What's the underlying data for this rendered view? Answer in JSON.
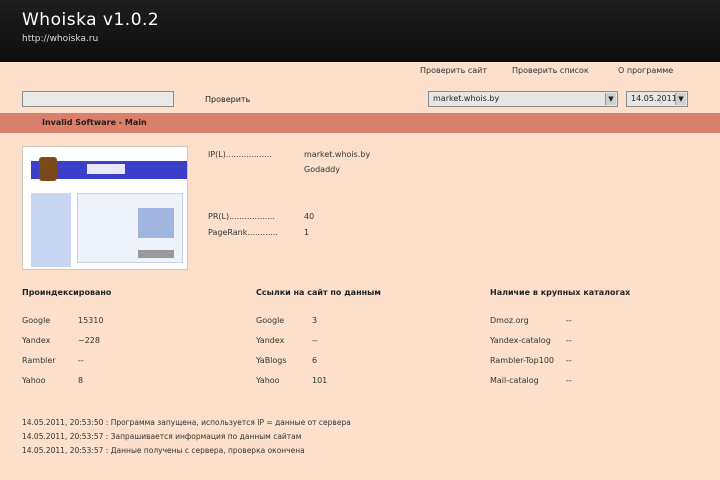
{
  "app": {
    "title": "Whoiska v1.0.2",
    "subtitle": "http://whoiska.ru"
  },
  "menu": {
    "item1": "Проверить сайт",
    "item2": "Проверить список",
    "item3": "О программе"
  },
  "toolbar": {
    "url_value": "",
    "check_label": "Проверить",
    "region_select": "market.whois.by",
    "date_select": "14.05.2011"
  },
  "tab": {
    "label": "Invalid Software - Main"
  },
  "site_info": {
    "ip_label": "IP(L)..................",
    "ip_value1": "market.whois.by",
    "ip_value2": "Godaddy",
    "pr_label": "PR(L)..................",
    "pr_value": "40",
    "pagerank_label": "PageRank............",
    "pagerank_value": "1"
  },
  "sections": {
    "indexation": {
      "title": "Проиндексировано",
      "rows": [
        {
          "label": "Google",
          "value": "15310"
        },
        {
          "label": "Yandex",
          "value": "~228"
        },
        {
          "label": "Rambler",
          "value": "--"
        },
        {
          "label": "Yahoo",
          "value": "8"
        }
      ]
    },
    "links": {
      "title": "Ссылки на сайт по данным",
      "rows": [
        {
          "label": "Google",
          "value": "3"
        },
        {
          "label": "Yandex",
          "value": "--"
        },
        {
          "label": "YaBlogs",
          "value": "6"
        },
        {
          "label": "Yahoo",
          "value": "101"
        }
      ]
    },
    "catalogs": {
      "title": "Наличие в крупных каталогах",
      "rows": [
        {
          "label": "Dmoz.org",
          "value": "--"
        },
        {
          "label": "Yandex-catalog",
          "value": "--"
        },
        {
          "label": "Rambler-Top100",
          "value": "--"
        },
        {
          "label": "Mail-catalog",
          "value": "--"
        }
      ]
    }
  },
  "log": [
    "14.05.2011, 20:53:50 : Программа запущена, используется IP = данные от сервера",
    "14.05.2011, 20:53:57 : Запрашивается информация по данным сайтам",
    "14.05.2011, 20:53:57 : Данные получены с сервера, проверка окончена"
  ]
}
